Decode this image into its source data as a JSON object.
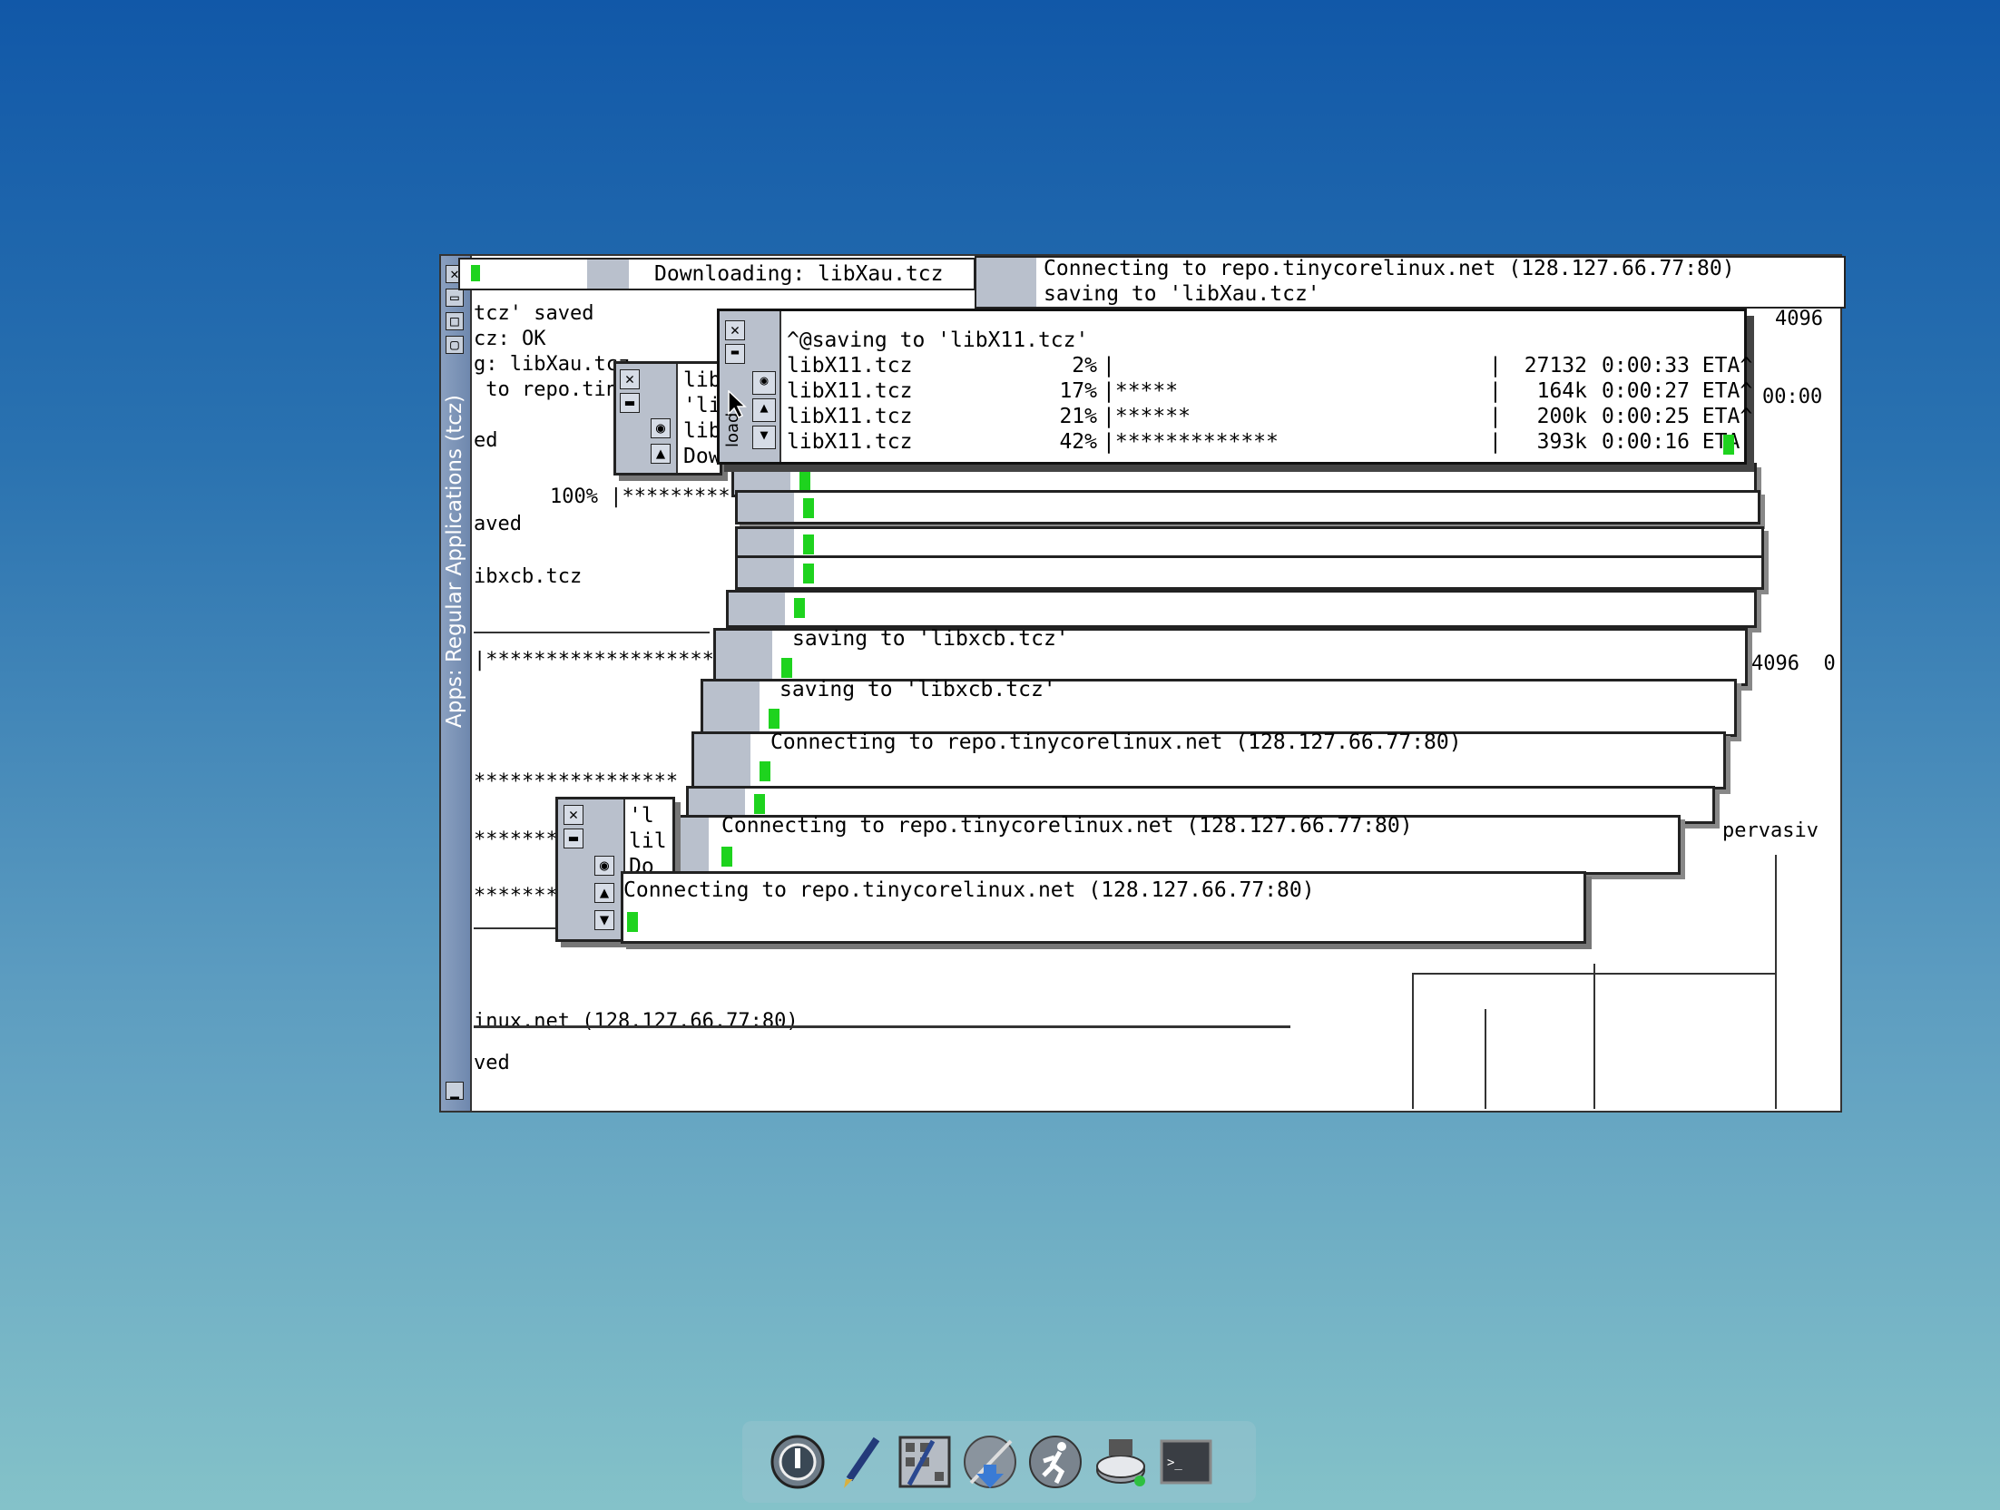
{
  "desktop": {
    "background_top": "#1158a8",
    "background_bottom": "#84c2c9"
  },
  "apps_window": {
    "title": "Apps: Regular Applications (tcz)",
    "background_lines": [
      "tcz' saved",
      "cz: OK",
      "g: libXau.tcz",
      " to repo.tin",
      "ed",
      "100% |*********",
      "aved",
      "ibxcb.tcz",
      "|*******************",
      "*****************",
      "*********",
      "*********",
      "inux.net (128.127.66.77:80)",
      "ved"
    ],
    "right_texts": [
      "4096",
      "4096  0",
      "00:00",
      "pervasiv"
    ]
  },
  "top_windows": {
    "download_title": "Downloading: libXau.tcz",
    "connect_line1": "Connecting to repo.tinycorelinux.net (128.127.66.77:80)",
    "connect_line2": "saving to 'libXau.tcz'"
  },
  "main_terminal": {
    "header": "^@saving to 'libX11.tcz'",
    "rows": [
      {
        "file": "libX11.tcz",
        "pct": "2%",
        "bar": "|",
        "size": "27132",
        "eta": "0:00:33 ETA^"
      },
      {
        "file": "libX11.tcz",
        "pct": "17%",
        "bar": "|*****",
        "size": "164k",
        "eta": "0:00:27 ETA^"
      },
      {
        "file": "libX11.tcz",
        "pct": "21%",
        "bar": "|******",
        "size": "200k",
        "eta": "0:00:25 ETA^"
      },
      {
        "file": "libX11.tcz",
        "pct": "42%",
        "bar": "|*************",
        "size": "393k",
        "eta": "0:00:16 ETA"
      }
    ]
  },
  "stacked_terminals": [
    {
      "text": "saving to 'libxcb.tcz'"
    },
    {
      "text": "saving to 'libxcb.tcz'"
    },
    {
      "text": "Connecting to repo.tinycorelinux.net (128.127.66.77:80)"
    },
    {
      "text": "Connecting to repo.tinycorelinux.net (128.127.66.77:80)"
    }
  ],
  "small_terms": {
    "left_a": [
      "lib",
      "'li",
      "lib",
      "Dow"
    ],
    "left_b": [
      "'l",
      "lil",
      "Do"
    ],
    "connect_front": "Connecting to repo.tinycorelinux.net (128.127.66.77:80)",
    "vertical_label": "load"
  },
  "taskbar": {
    "icons": [
      "power-icon",
      "editor-pen-icon",
      "control-panel-icon",
      "apps-download-icon",
      "run-icon",
      "mount-tool-icon",
      "terminal-icon"
    ]
  }
}
